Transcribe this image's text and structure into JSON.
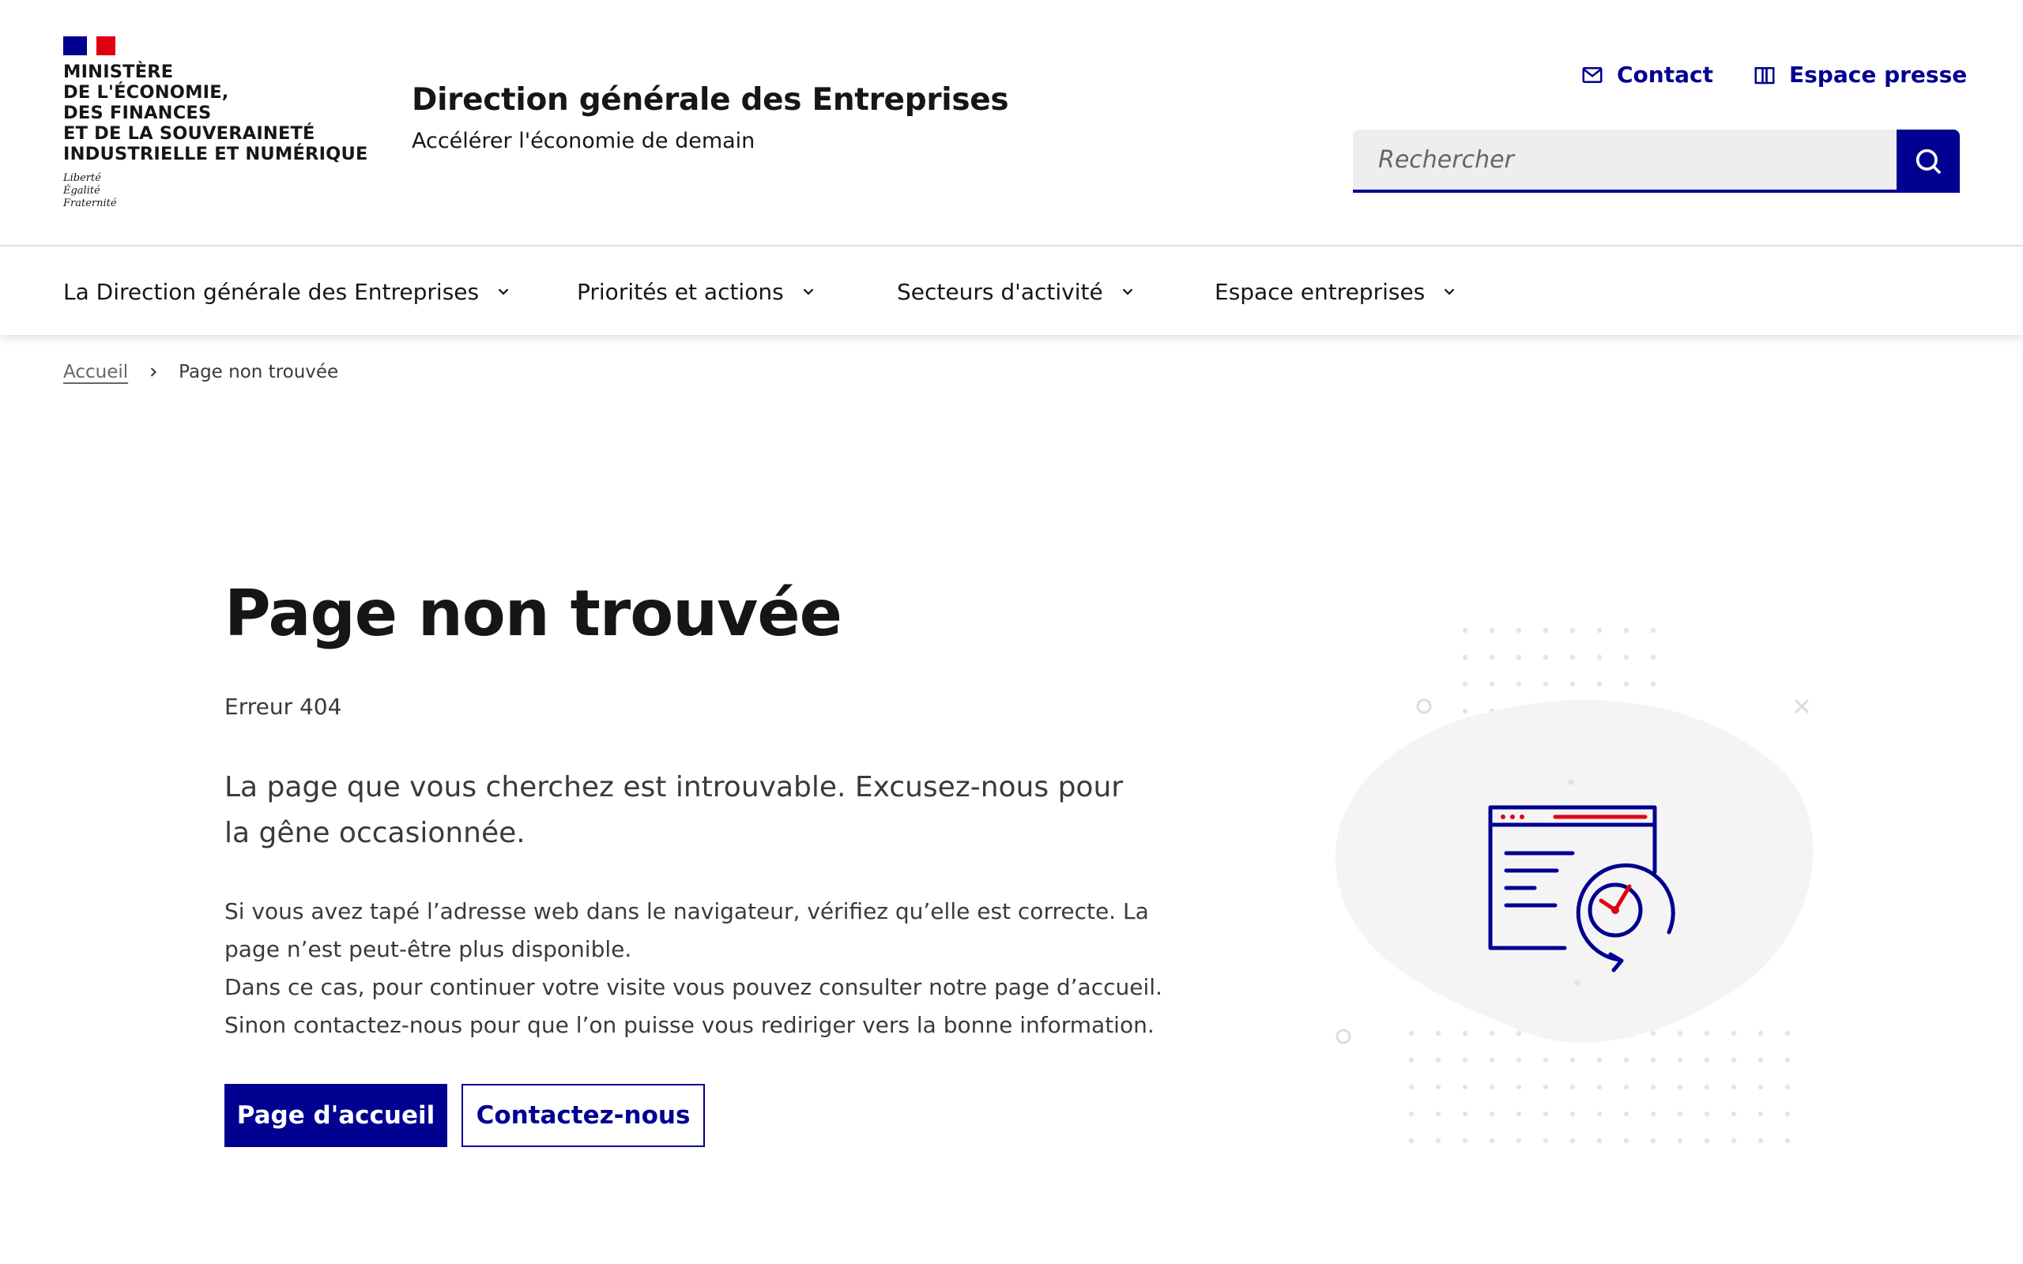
{
  "header": {
    "ministry": "Ministère\nde l'économie,\ndes finances\net de la souveraineté\nindustrielle et numérique",
    "motto": "Liberté\nÉgalité\nFraternité",
    "service_title": "Direction générale des Entreprises",
    "service_tagline": "Accélérer l'économie de demain",
    "quick_links": {
      "contact": "Contact",
      "presse": "Espace presse"
    },
    "search": {
      "placeholder": "Rechercher",
      "button_icon": "search-icon"
    }
  },
  "nav": {
    "items": [
      {
        "label": "La Direction générale des Entreprises"
      },
      {
        "label": "Priorités et actions"
      },
      {
        "label": "Secteurs d'activité"
      },
      {
        "label": "Espace entreprises"
      }
    ]
  },
  "breadcrumb": {
    "home": "Accueil",
    "current": "Page non trouvée"
  },
  "main": {
    "title": "Page non trouvée",
    "error_code": "Erreur 404",
    "lead": "La page que vous cherchez est introuvable. Excusez-nous pour la gêne occasionnée.",
    "body": [
      "Si vous avez tapé l’adresse web dans le navigateur, vérifiez qu’elle est correcte. La page n’est peut-être plus disponible.",
      "Dans ce cas, pour continuer votre visite vous pouvez consulter notre page d’accueil.",
      "Sinon contactez-nous pour que l’on puisse vous rediriger vers la bonne information."
    ],
    "buttons": {
      "primary": "Page d'accueil",
      "secondary": "Contactez-nous"
    }
  },
  "colors": {
    "blue_france": "#000091",
    "red_marianne": "#e1000f",
    "text": "#161616",
    "text_muted": "#3a3a3a",
    "input_bg": "#eeeeee",
    "illustration_blob": "#f4f4f4"
  },
  "icons": {
    "contact": "mail-icon",
    "presse": "book-icon",
    "nav_chevron": "chevron-down-icon",
    "breadcrumb_sep": "chevron-right-icon",
    "illustration": "browser-clock-illustration"
  }
}
